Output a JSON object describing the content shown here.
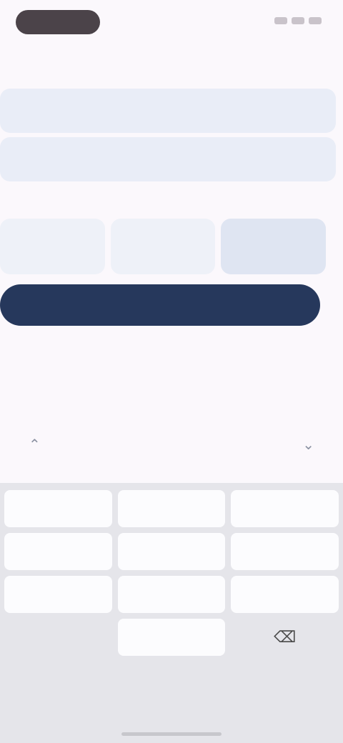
{
  "header": {
    "title": ""
  },
  "fields": [
    {
      "label": "",
      "value": "",
      "placeholder": ""
    },
    {
      "label": "",
      "value": "",
      "placeholder": ""
    }
  ],
  "section": {
    "label": ""
  },
  "segments": [
    {
      "label": "",
      "selected": false
    },
    {
      "label": "",
      "selected": false
    },
    {
      "label": "",
      "selected": true
    }
  ],
  "primary_button": {
    "label": ""
  },
  "keyboard": {
    "keys": [
      "",
      "",
      "",
      "",
      "",
      "",
      "",
      "",
      "",
      "",
      "",
      ""
    ]
  },
  "colors": {
    "accent": "#26385c",
    "field_background": "#e9edf7",
    "page_background": "#fbf8fc",
    "keyboard_background": "#e5e5ea"
  },
  "icons": {
    "toolbar_left": "chevron-up-icon",
    "toolbar_right": "chevron-down-icon",
    "backspace": "backspace-icon"
  }
}
